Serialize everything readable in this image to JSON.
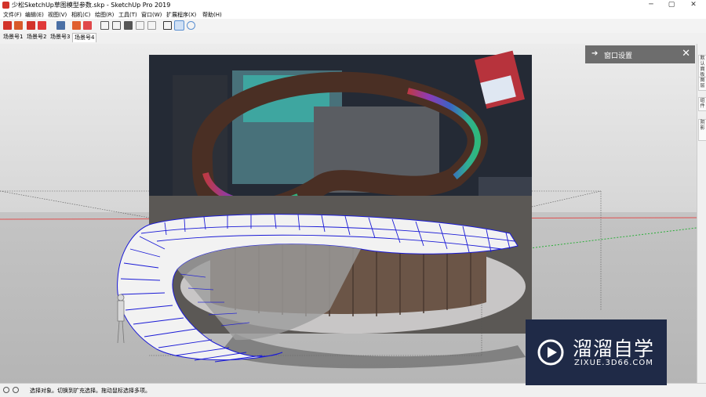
{
  "window": {
    "title": "少松SketchUp草图模型参数.skp - SketchUp Pro 2019",
    "minimize": "─",
    "maximize": "▢",
    "close": "✕"
  },
  "menu": [
    {
      "label": "文件(F)"
    },
    {
      "label": "编辑(E)"
    },
    {
      "label": "视图(V)"
    },
    {
      "label": "相机(C)"
    },
    {
      "label": "绘图(R)"
    },
    {
      "label": "工具(T)"
    },
    {
      "label": "窗口(W)"
    },
    {
      "label": "扩展程序(X)"
    },
    {
      "label": "帮助(H)"
    }
  ],
  "scene_tabs": [
    {
      "label": "场景号1"
    },
    {
      "label": "场景号2"
    },
    {
      "label": "场景号3"
    },
    {
      "label": "场景号4",
      "selected": true
    }
  ],
  "panel": {
    "title": "窗口设置",
    "arrow_icon": "arrow-right-icon",
    "close": "✕"
  },
  "side_tabs": [
    {
      "label": "默认面板"
    },
    {
      "label": "图层"
    },
    {
      "label": "组件"
    },
    {
      "label": "阴影"
    }
  ],
  "status": {
    "message": "选择对象。切换到扩充选择。拖动鼠标选择多项。"
  },
  "watermark": {
    "brand": "溜溜自学",
    "url": "ZIXUE.3D66.COM"
  },
  "colors": {
    "sketchup_red": "#d2332a",
    "panel_bg": "#6d6d6d",
    "watermark_bg": "#1f2a47",
    "model_edge_blue": "#1a1ad6",
    "axis_red": "#e05050"
  }
}
